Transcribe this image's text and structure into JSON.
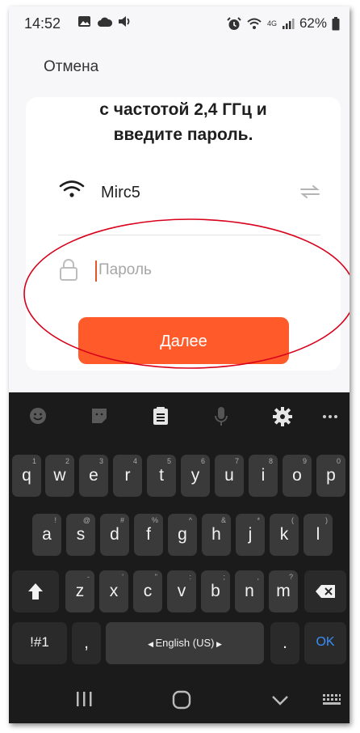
{
  "status_bar": {
    "time": "14:52",
    "battery_percent": "62%",
    "network_label": "4G",
    "icons": [
      "image-icon",
      "cloud-icon",
      "volume-icon",
      "alarm-icon",
      "wifi-icon",
      "signal-icon",
      "battery-icon"
    ]
  },
  "header": {
    "cancel_label": "Отмена"
  },
  "card": {
    "instruction_line1": "с частотой 2,4 ГГц и",
    "instruction_line2": "введите пароль.",
    "ssid": "Mirc5",
    "password_value": "",
    "password_placeholder": "Пароль",
    "next_label": "Далее"
  },
  "colors": {
    "accent": "#ff5a2a",
    "annotation": "#d9001b",
    "keyboard_bg": "#1b1b1b",
    "key_bg": "#3a3a3a",
    "ok_text": "#3b8ef5"
  },
  "keyboard": {
    "toolbar_icons": [
      "emoji-icon",
      "sticker-icon",
      "clipboard-icon",
      "mic-icon",
      "settings-icon",
      "more-icon"
    ],
    "row1": [
      {
        "k": "q",
        "s": "1"
      },
      {
        "k": "w",
        "s": "2"
      },
      {
        "k": "e",
        "s": "3"
      },
      {
        "k": "r",
        "s": "4"
      },
      {
        "k": "t",
        "s": "5"
      },
      {
        "k": "y",
        "s": "6"
      },
      {
        "k": "u",
        "s": "7"
      },
      {
        "k": "i",
        "s": "8"
      },
      {
        "k": "o",
        "s": "9"
      },
      {
        "k": "p",
        "s": "0"
      }
    ],
    "row2": [
      {
        "k": "a",
        "s": "!"
      },
      {
        "k": "s",
        "s": "@"
      },
      {
        "k": "d",
        "s": "#"
      },
      {
        "k": "f",
        "s": "%"
      },
      {
        "k": "g",
        "s": "^"
      },
      {
        "k": "h",
        "s": "&"
      },
      {
        "k": "j",
        "s": "*"
      },
      {
        "k": "k",
        "s": "("
      },
      {
        "k": "l",
        "s": ")"
      }
    ],
    "row3": [
      {
        "k": "z",
        "s": "-"
      },
      {
        "k": "x",
        "s": "'"
      },
      {
        "k": "c",
        "s": "\""
      },
      {
        "k": "v",
        "s": ":"
      },
      {
        "k": "b",
        "s": ";"
      },
      {
        "k": "n",
        "s": ","
      },
      {
        "k": "m",
        "s": "?"
      }
    ],
    "symbols_label": "!#1",
    "comma_label": ",",
    "space_label": "English (US)",
    "period_label": ".",
    "ok_label": "OK"
  },
  "nav_bar": {
    "icons": [
      "recent-apps-icon",
      "home-icon",
      "back-icon",
      "keyboard-switch-icon"
    ]
  }
}
